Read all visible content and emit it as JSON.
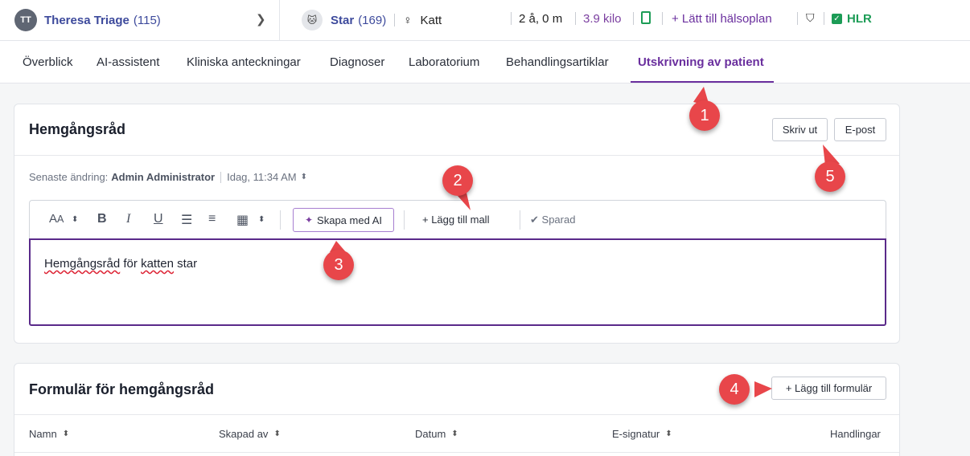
{
  "header": {
    "owner_initials": "TT",
    "owner_name": "Theresa Triage",
    "owner_count": "(115)",
    "pet_name": "Star",
    "pet_count": "(169)",
    "species": "Katt",
    "age": "2 å, 0 m",
    "weight": "3.9 kilo",
    "add_plan": "+ Lätt till hälsoplan",
    "hlr": "HLR"
  },
  "tabs": [
    {
      "label": "Överblick"
    },
    {
      "label": "AI-assistent"
    },
    {
      "label": "Kliniska anteckningar"
    },
    {
      "label": "Diagnoser"
    },
    {
      "label": "Laboratorium"
    },
    {
      "label": "Behandlingsartiklar"
    },
    {
      "label": "Utskrivning av patient"
    }
  ],
  "advice": {
    "title": "Hemgångsråd",
    "print_label": "Skriv ut",
    "email_label": "E-post",
    "meta_prefix": "Senaste ändring:",
    "meta_author": "Admin Administrator",
    "meta_time": "Idag, 11:34 AM",
    "ai_label": "Skapa med AI",
    "template_label": "+ Lägg till mall",
    "saved_label": "Sparad",
    "editor_word1": "Hemgångsråd",
    "editor_mid": " för ",
    "editor_word2": "katten",
    "editor_end": " star"
  },
  "forms": {
    "title": "Formulär för hemgångsråd",
    "add_label": "+ Lägg till formulär",
    "columns": [
      "Namn",
      "Skapad av",
      "Datum",
      "E-signatur",
      "Handlingar"
    ]
  },
  "markers": [
    "1",
    "2",
    "3",
    "4",
    "5"
  ],
  "colors": {
    "accent": "#6a2f9e",
    "marker": "#e8464a",
    "link": "#3d4a9c",
    "success": "#1c9c56"
  }
}
